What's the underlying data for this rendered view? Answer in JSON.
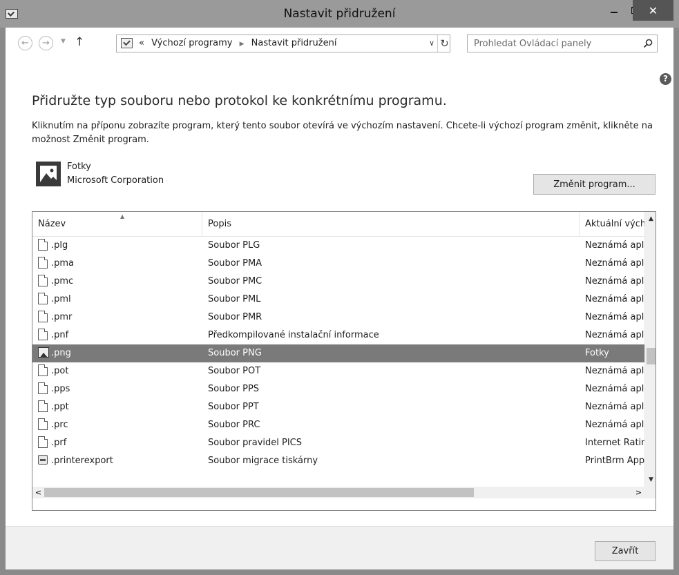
{
  "window": {
    "title": "Nastavit přidružení",
    "close_glyph": "✕"
  },
  "nav": {
    "back_glyph": "←",
    "forward_glyph": "→",
    "recent_glyph": "▼",
    "up_glyph": "↑",
    "breadcrumb_prefix": "«",
    "breadcrumb_sep": "▶",
    "breadcrumb": [
      "Výchozí programy",
      "Nastavit přidružení"
    ],
    "dropdown_glyph": "∨",
    "refresh_glyph": "↻",
    "search_placeholder": "Prohledat Ovládací panely"
  },
  "help_glyph": "?",
  "heading": "Přidružte typ souboru nebo protokol ke konkrétnímu programu.",
  "description": "Kliknutím na příponu zobrazíte program, který tento soubor otevírá ve výchozím nastavení. Chcete-li výchozí program změnit, klikněte na možnost Změnit program.",
  "program": {
    "name": "Fotky",
    "vendor": "Microsoft Corporation",
    "change_button": "Změnit program..."
  },
  "list": {
    "columns": [
      "Název",
      "Popis",
      "Aktuální výchozí"
    ],
    "sort_glyph": "▲",
    "scroll_glyphs": {
      "up": "▲",
      "down": "▼",
      "left": "<",
      "right": ">"
    },
    "rows": [
      {
        "ext": ".plg",
        "desc": "Soubor PLG",
        "current": "Neznámá aplikace",
        "icon": "file-icon"
      },
      {
        "ext": ".pma",
        "desc": "Soubor PMA",
        "current": "Neznámá aplikace",
        "icon": "file-icon"
      },
      {
        "ext": ".pmc",
        "desc": "Soubor PMC",
        "current": "Neznámá aplikace",
        "icon": "file-icon"
      },
      {
        "ext": ".pml",
        "desc": "Soubor PML",
        "current": "Neznámá aplikace",
        "icon": "file-icon"
      },
      {
        "ext": ".pmr",
        "desc": "Soubor PMR",
        "current": "Neznámá aplikace",
        "icon": "file-icon"
      },
      {
        "ext": ".pnf",
        "desc": "Předkompilované instalační informace",
        "current": "Neznámá aplikace",
        "icon": "file-icon"
      },
      {
        "ext": ".png",
        "desc": "Soubor PNG",
        "current": "Fotky",
        "icon": "image-icon",
        "selected": true
      },
      {
        "ext": ".pot",
        "desc": "Soubor POT",
        "current": "Neznámá aplikace",
        "icon": "file-icon"
      },
      {
        "ext": ".pps",
        "desc": "Soubor PPS",
        "current": "Neznámá aplikace",
        "icon": "file-icon"
      },
      {
        "ext": ".ppt",
        "desc": "Soubor PPT",
        "current": "Neznámá aplikace",
        "icon": "file-icon"
      },
      {
        "ext": ".prc",
        "desc": "Soubor PRC",
        "current": "Neznámá aplikace",
        "icon": "file-icon"
      },
      {
        "ext": ".prf",
        "desc": "Soubor pravidel PICS",
        "current": "Internet Ratings",
        "icon": "file-icon"
      },
      {
        "ext": ".printerexport",
        "desc": "Soubor migrace tiskárny",
        "current": "PrintBrm Application",
        "icon": "printer-icon"
      }
    ]
  },
  "footer": {
    "close_button": "Zavřít"
  }
}
